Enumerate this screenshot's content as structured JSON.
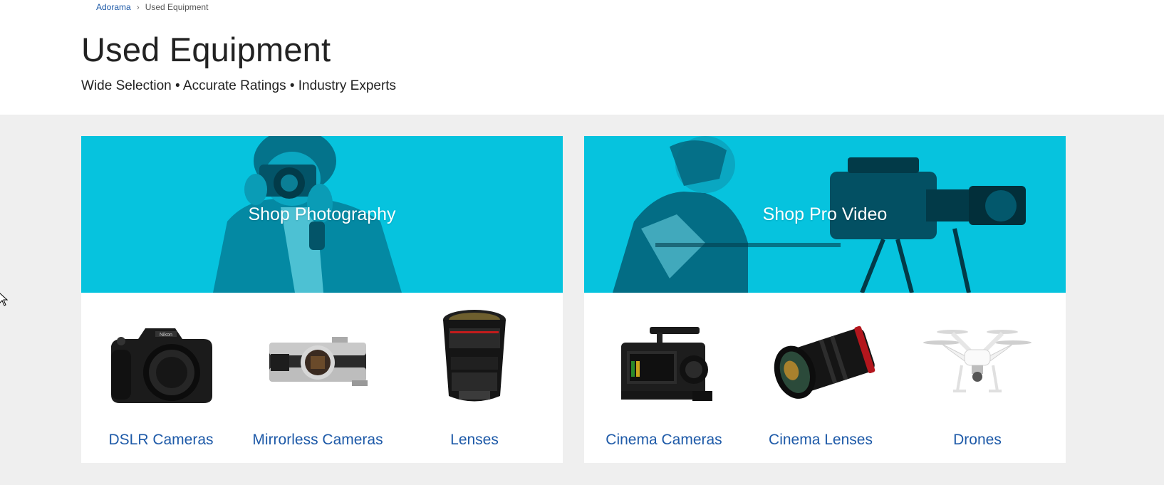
{
  "breadcrumb": {
    "home": "Adorama",
    "current": "Used Equipment"
  },
  "page": {
    "title": "Used Equipment",
    "tagline": "Wide Selection • Accurate Ratings • Industry Experts"
  },
  "sections": {
    "photography": {
      "cta": "Shop Photography",
      "categories": [
        {
          "label": "DSLR Cameras"
        },
        {
          "label": "Mirrorless Cameras"
        },
        {
          "label": "Lenses"
        }
      ]
    },
    "video": {
      "cta": "Shop Pro Video",
      "categories": [
        {
          "label": "Cinema Cameras"
        },
        {
          "label": "Cinema Lenses"
        },
        {
          "label": "Drones"
        }
      ]
    }
  },
  "colors": {
    "hero": "#06c3de",
    "link": "#1e5aa8",
    "band": "#efefef"
  },
  "icons": {
    "separator": "chevron-right-icon",
    "cursor": "mouse-pointer-icon"
  }
}
